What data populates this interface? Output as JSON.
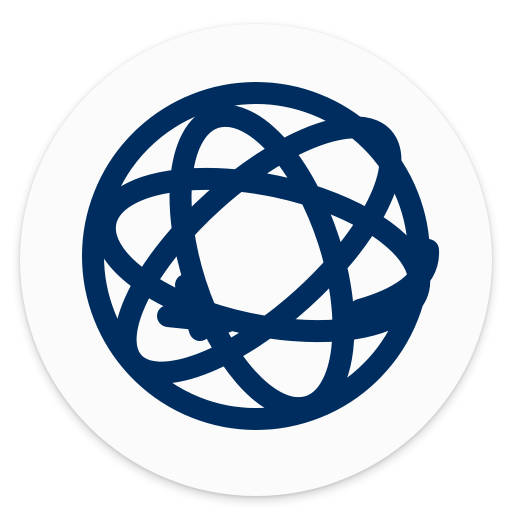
{
  "app_icon": {
    "icon": "globe-orbit-icon",
    "background_color": "#fbfbfb",
    "logo_color": "#002d5f"
  }
}
